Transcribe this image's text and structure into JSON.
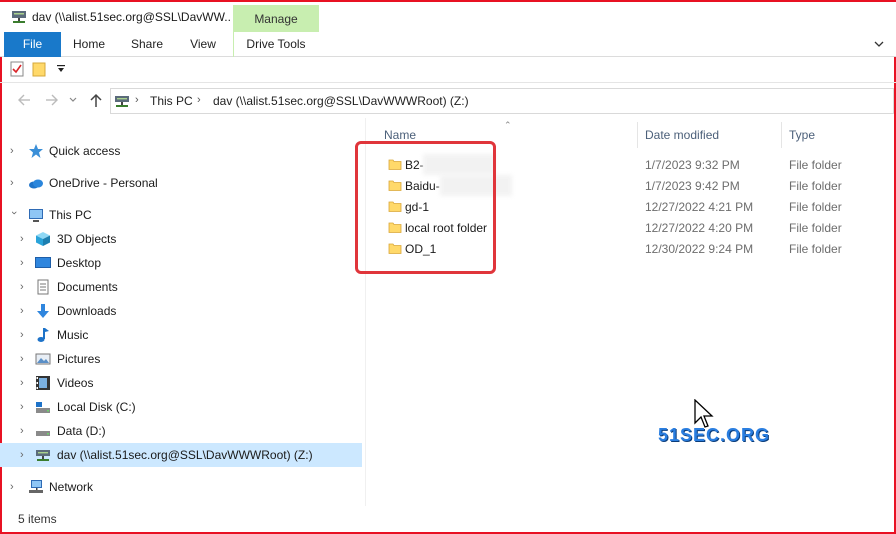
{
  "window": {
    "title": "dav (\\\\alist.51sec.org@SSL\\DavWW...",
    "context_tab": "Manage",
    "accent_color": "#1979ca",
    "border_color": "#e81123"
  },
  "ribbon": {
    "tabs": [
      "File",
      "Home",
      "Share",
      "View",
      "Drive Tools"
    ]
  },
  "address": {
    "crumbs": [
      "This PC",
      "dav (\\\\alist.51sec.org@SSL\\DavWWWRoot) (Z:)"
    ]
  },
  "navpane": {
    "items": [
      {
        "label": "Quick access",
        "icon": "star-icon"
      },
      {
        "label": "OneDrive - Personal",
        "icon": "cloud-icon"
      },
      {
        "label": "This PC",
        "icon": "computer-icon"
      },
      {
        "label": "3D Objects",
        "icon": "cube-icon"
      },
      {
        "label": "Desktop",
        "icon": "desktop-icon"
      },
      {
        "label": "Documents",
        "icon": "document-icon"
      },
      {
        "label": "Downloads",
        "icon": "download-icon"
      },
      {
        "label": "Music",
        "icon": "music-icon"
      },
      {
        "label": "Pictures",
        "icon": "pictures-icon"
      },
      {
        "label": "Videos",
        "icon": "video-icon"
      },
      {
        "label": "Local Disk (C:)",
        "icon": "disk-icon"
      },
      {
        "label": "Data (D:)",
        "icon": "disk-icon"
      },
      {
        "label": "dav (\\\\alist.51sec.org@SSL\\DavWWWRoot) (Z:)",
        "icon": "network-drive-icon"
      },
      {
        "label": "Network",
        "icon": "network-icon"
      }
    ]
  },
  "filelist": {
    "columns": [
      "Name",
      "Date modified",
      "Type"
    ],
    "rows": [
      {
        "name": "B2-",
        "date": "1/7/2023 9:32 PM",
        "type": "File folder"
      },
      {
        "name": "Baidu-",
        "date": "1/7/2023 9:42 PM",
        "type": "File folder"
      },
      {
        "name": "gd-1",
        "date": "12/27/2022 4:21 PM",
        "type": "File folder"
      },
      {
        "name": "local root folder",
        "date": "12/27/2022 4:20 PM",
        "type": "File folder"
      },
      {
        "name": "OD_1",
        "date": "12/30/2022 9:24 PM",
        "type": "File folder"
      }
    ]
  },
  "watermark": "51SEC.ORG",
  "status": {
    "count": "5 items"
  }
}
